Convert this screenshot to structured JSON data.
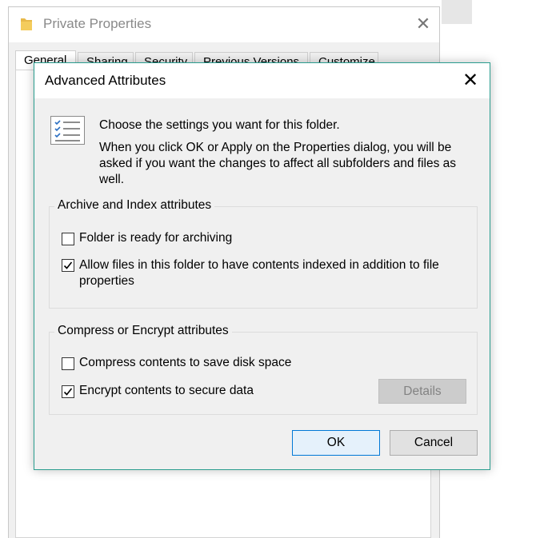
{
  "background_window": {
    "title": "Private Properties",
    "tabs": [
      "General",
      "Sharing",
      "Security",
      "Previous Versions",
      "Customize"
    ]
  },
  "dialog": {
    "title": "Advanced Attributes",
    "intro_line": "Choose the settings you want for this folder.",
    "intro_detail": "When you click OK or Apply on the Properties dialog, you will be asked if you want the changes to affect all subfolders and files as well.",
    "archive_group": {
      "label": "Archive and Index attributes",
      "ready_for_archiving": {
        "label": "Folder is ready for archiving",
        "checked": false
      },
      "index_contents": {
        "label": "Allow files in this folder to have contents indexed in addition to file properties",
        "checked": true
      }
    },
    "compress_group": {
      "label": "Compress or Encrypt attributes",
      "compress": {
        "label": "Compress contents to save disk space",
        "checked": false
      },
      "encrypt": {
        "label": "Encrypt contents to secure data",
        "checked": true
      },
      "details_label": "Details"
    },
    "ok_label": "OK",
    "cancel_label": "Cancel"
  },
  "icons": {
    "close": "close-icon",
    "folder": "folder-icon",
    "checklist": "checklist-document-icon"
  },
  "colors": {
    "dialog_border": "#2a9d8f",
    "primary_button_border": "#0078d7",
    "primary_button_bg": "#e5f1fb",
    "checklist_blue": "#2b6fc2"
  }
}
